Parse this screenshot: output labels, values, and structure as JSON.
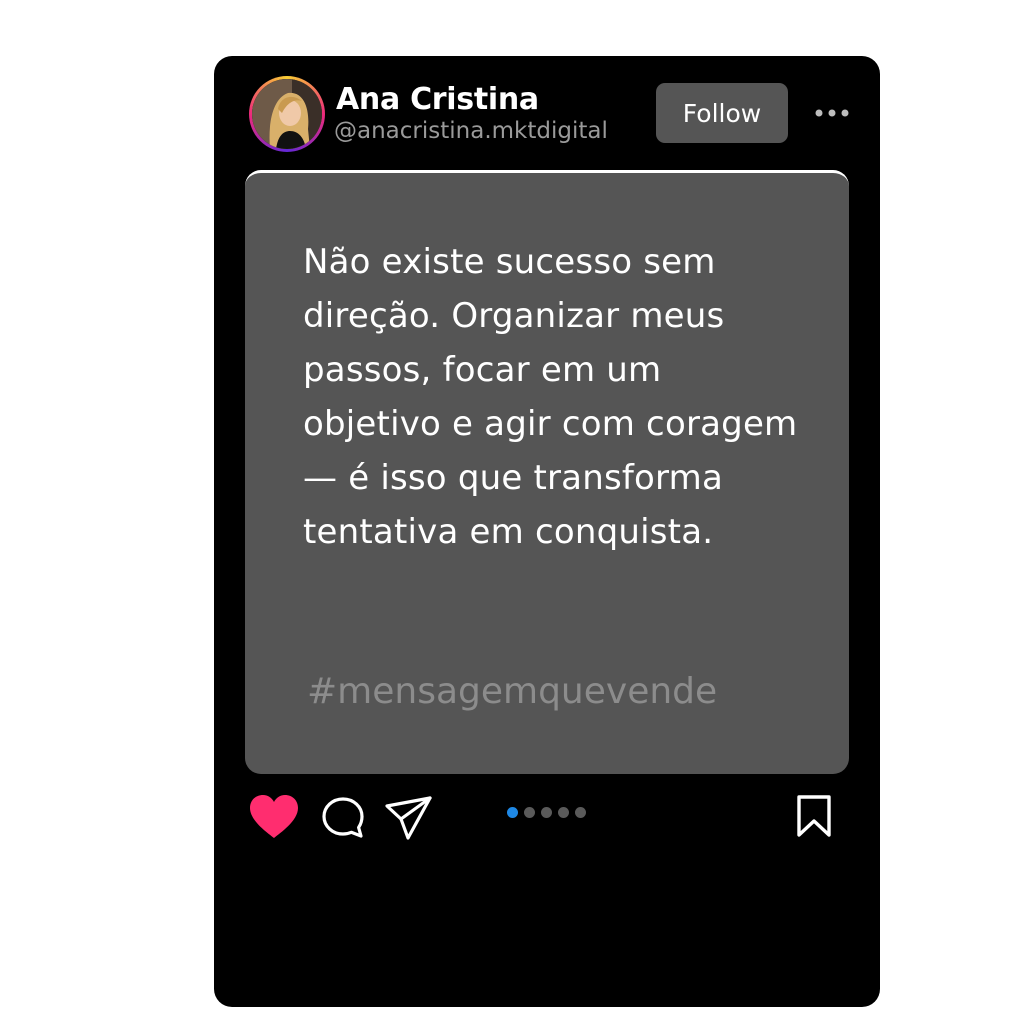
{
  "profile": {
    "name": "Ana Cristina",
    "handle": "@anacristina.mktdigital",
    "follow_label": "Follow"
  },
  "post": {
    "text": "Não existe sucesso sem direção. Organizar meus passos, focar em um objetivo e agir com coragem — é isso que transforma tentativa em conquista.",
    "hashtag": "#mensagemquevende"
  },
  "carousel": {
    "total": 5,
    "active": 1
  },
  "actions": {
    "liked": true,
    "icons": [
      "heart-icon",
      "comment-icon",
      "share-icon",
      "bookmark-icon",
      "more-icon"
    ]
  },
  "colors": {
    "card_bg": "#000000",
    "post_bg": "#555555",
    "like": "#ff2d6f",
    "active_dot": "#1e88e5",
    "hashtag": "#8c8c8c"
  }
}
